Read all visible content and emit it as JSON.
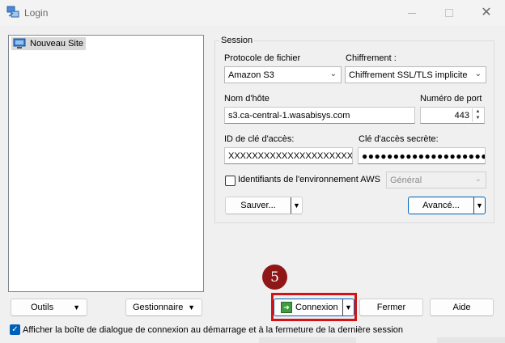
{
  "window": {
    "title": "Login",
    "close_symbol": "✕"
  },
  "site_tree": {
    "items": [
      {
        "label": "Nouveau Site"
      }
    ]
  },
  "session": {
    "group_title": "Session",
    "protocol": {
      "label": "Protocole de fichier",
      "value": "Amazon S3"
    },
    "encryption": {
      "label": "Chiffrement :",
      "value": "Chiffrement SSL/TLS implicite"
    },
    "host": {
      "label": "Nom d'hôte",
      "value": "s3.ca-central-1.wasabisys.com"
    },
    "port": {
      "label": "Numéro de port",
      "value": "443"
    },
    "access_key": {
      "label": "ID de clé d'accès:",
      "value": "XXXXXXXXXXXXXXXXXXXXX"
    },
    "secret_key": {
      "label": "Clé d'accès secrète:",
      "value": "●●●●●●●●●●●●●●●●●●●●●●"
    },
    "aws_env": {
      "label": "Identifiants de l'environnement AWS",
      "checked": false,
      "profile_value": "Général"
    },
    "save_label": "Sauver...",
    "advanced_label": "Avancé..."
  },
  "bottom": {
    "tools_label": "Outils",
    "manager_label": "Gestionnaire",
    "connect_label": "Connexion",
    "close_label": "Fermer",
    "help_label": "Aide",
    "show_dialog_label": "Afficher la boîte de dialogue de connexion au démarrage et à la fermeture de la dernière session",
    "show_dialog_checked": true
  },
  "annotation": {
    "step_number": "5",
    "highlight_color": "#d21414",
    "badge_color": "#8f1717"
  },
  "colors": {
    "accent": "#005fb8",
    "window_bg": "#f0f0f0"
  }
}
